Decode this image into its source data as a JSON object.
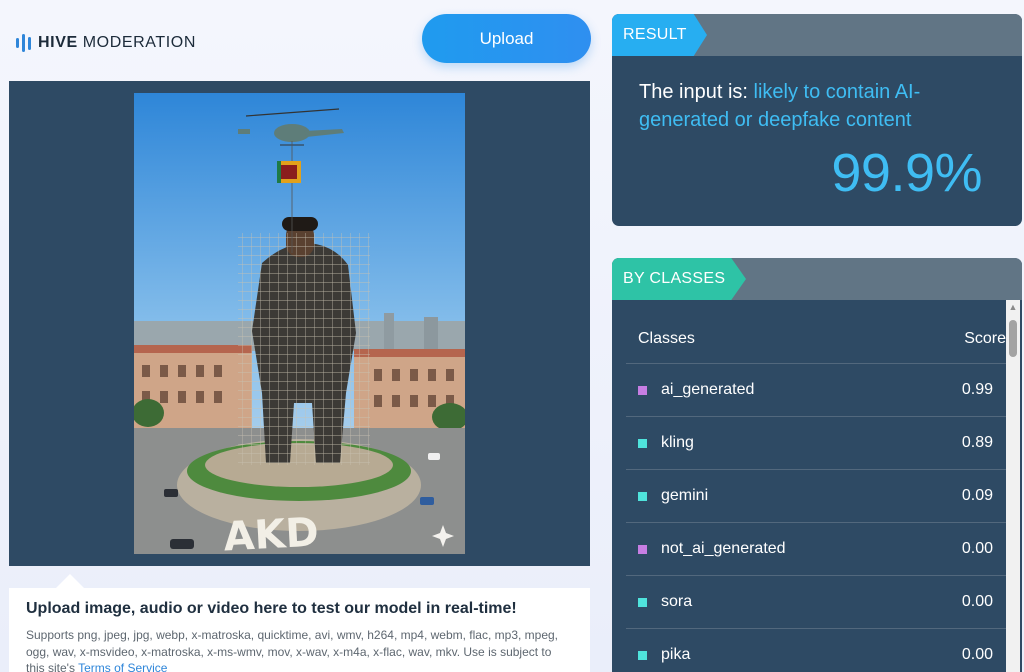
{
  "header": {
    "brand_bold": "HIVE",
    "brand_light": "MODERATION",
    "upload_label": "Upload"
  },
  "preview": {
    "image_overlay_text": "AKD"
  },
  "info": {
    "title": "Upload image, audio or video here to test our model in real-time!",
    "desc_prefix": "Supports png, jpeg, jpg, webp, x-matroska, quicktime, avi, wmv, h264, mp4, webm, flac, mp3, mpeg, ogg, wav, x-msvideo, x-matroska, x-ms-wmv, mov, x-wav, x-m4a, x-flac, wav, mkv. Use is subject to this site's",
    "terms_link": "Terms of Service"
  },
  "result": {
    "tag": "RESULT",
    "prefix": "The input is:",
    "highlight": "likely to contain AI-generated or deepfake content",
    "percent": "99.9%"
  },
  "classes": {
    "tag": "BY CLASSES",
    "col_class": "Classes",
    "col_score": "Score",
    "rows": [
      {
        "name": "ai_generated",
        "score": "0.99",
        "color": "#c77ee3"
      },
      {
        "name": "kling",
        "score": "0.89",
        "color": "#4fe3dc"
      },
      {
        "name": "gemini",
        "score": "0.09",
        "color": "#4fe3dc"
      },
      {
        "name": "not_ai_generated",
        "score": "0.00",
        "color": "#c77ee3"
      },
      {
        "name": "sora",
        "score": "0.00",
        "color": "#4fe3dc"
      },
      {
        "name": "pika",
        "score": "0.00",
        "color": "#4fe3dc"
      }
    ]
  },
  "colors": {
    "accent_blue": "#27aef1",
    "accent_teal": "#2ec3a6",
    "panel": "#2e4a64"
  }
}
